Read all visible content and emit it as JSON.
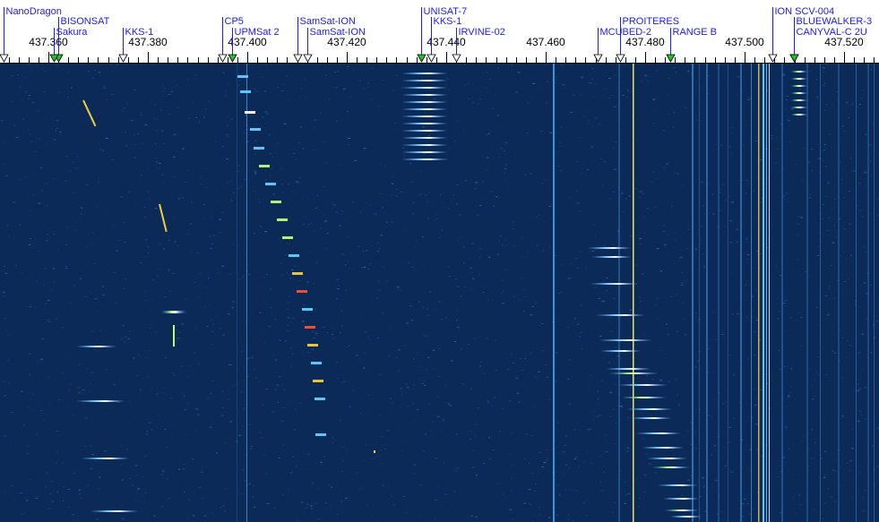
{
  "scale": {
    "start_mhz": 437.35,
    "step_mhz": 0.002,
    "tick_count": 90,
    "labels": [
      "437.360",
      "437.380",
      "437.400",
      "437.420",
      "437.440",
      "437.460",
      "437.480",
      "437.500",
      "437.520"
    ]
  },
  "colors": {
    "background": "#0b2a57",
    "label": "#1a1aff",
    "scale_text": "#000000",
    "marker_active": "#22c422",
    "marker_inactive": "#ffffff"
  },
  "satellites": [
    {
      "name": "NanoDragon",
      "freq_mhz": 437.351,
      "row": 0,
      "active": false
    },
    {
      "name": "BISONSAT",
      "freq_mhz": 437.362,
      "row": 1,
      "active": true
    },
    {
      "name": "Sakura",
      "freq_mhz": 437.361,
      "row": 2,
      "active": true
    },
    {
      "name": "KKS-1",
      "freq_mhz": 437.375,
      "row": 2,
      "active": false
    },
    {
      "name": "CP5",
      "freq_mhz": 437.395,
      "row": 1,
      "active": false
    },
    {
      "name": "UPMSat 2",
      "freq_mhz": 437.397,
      "row": 2,
      "active": true
    },
    {
      "name": "SamSat-ION",
      "freq_mhz": 437.41,
      "row": 1,
      "active": false
    },
    {
      "name": "SamSat-ION",
      "freq_mhz": 437.412,
      "row": 2,
      "active": false
    },
    {
      "name": "UNISAT-7",
      "freq_mhz": 437.435,
      "row": 0,
      "active": true
    },
    {
      "name": "KKS-1",
      "freq_mhz": 437.437,
      "row": 1,
      "active": false
    },
    {
      "name": "IRVINE-02",
      "freq_mhz": 437.442,
      "row": 2,
      "active": false
    },
    {
      "name": "MCUBED-2",
      "freq_mhz": 437.4705,
      "row": 2,
      "active": false
    },
    {
      "name": "PROITERES",
      "freq_mhz": 437.475,
      "row": 1,
      "active": false
    },
    {
      "name": "RANGE B",
      "freq_mhz": 437.485,
      "row": 2,
      "active": true
    },
    {
      "name": "ION SCV-004",
      "freq_mhz": 437.5055,
      "row": 0,
      "active": false
    },
    {
      "name": "BLUEWALKER-3",
      "freq_mhz": 437.51,
      "row": 1,
      "active": true
    },
    {
      "name": "CANYVAL-C 2U",
      "freq_mhz": 437.51,
      "row": 2,
      "active": true
    }
  ]
}
